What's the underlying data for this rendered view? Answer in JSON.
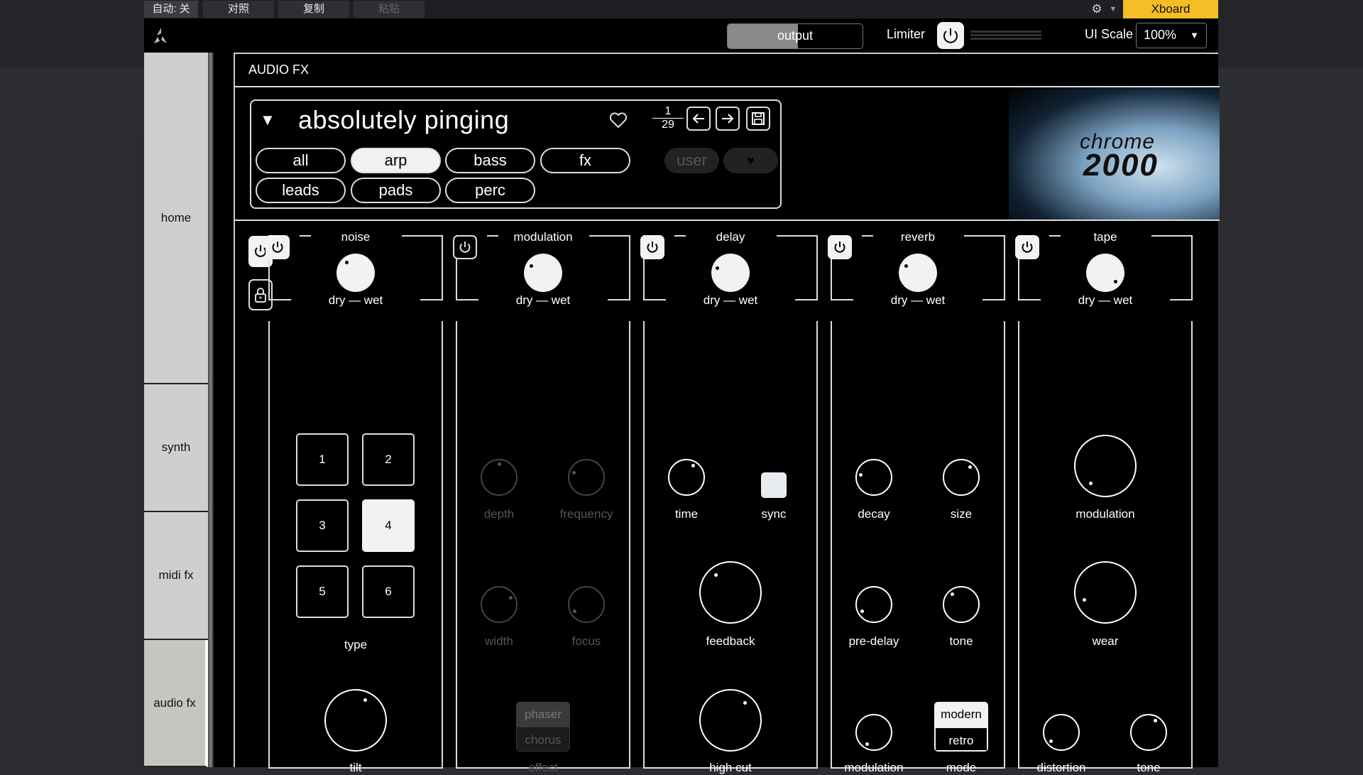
{
  "host": {
    "auto_label": "自动: 关",
    "compare_label": "对照",
    "copy_label": "复制",
    "paste_label": "粘贴",
    "xboard_label": "Xboard"
  },
  "top": {
    "output_label": "output",
    "output_level": 0.52,
    "limiter_label": "Limiter",
    "ui_scale_label": "UI Scale",
    "ui_scale_value": "100%"
  },
  "sidebar": {
    "items": [
      {
        "label": "home"
      },
      {
        "label": "synth"
      },
      {
        "label": "midi fx"
      },
      {
        "label": "audio fx"
      }
    ]
  },
  "header": {
    "title": "AUDIO FX"
  },
  "preset": {
    "name": "absolutely pinging",
    "index": "1",
    "total": "29",
    "categories": [
      "all",
      "arp",
      "bass",
      "fx",
      "leads",
      "pads",
      "perc"
    ],
    "selected": "arp",
    "user_label": "user"
  },
  "art": {
    "line1": "chrome",
    "line2": "2000"
  },
  "effects": {
    "drywet_label": "dry — wet",
    "noise": {
      "title": "noise",
      "type_label": "type",
      "types": [
        "1",
        "2",
        "3",
        "4",
        "5",
        "6"
      ],
      "selected_type": "4",
      "tilt_label": "tilt"
    },
    "modulation": {
      "title": "modulation",
      "depth_label": "depth",
      "frequency_label": "frequency",
      "width_label": "width",
      "focus_label": "focus",
      "effect_label": "effect",
      "effect_options": [
        "phaser",
        "chorus"
      ]
    },
    "delay": {
      "title": "delay",
      "time_label": "time",
      "sync_label": "sync",
      "feedback_label": "feedback",
      "highcut_label": "high cut"
    },
    "reverb": {
      "title": "reverb",
      "decay_label": "decay",
      "size_label": "size",
      "predelay_label": "pre-delay",
      "tone_label": "tone",
      "modulation_label": "modulation",
      "mode_label": "mode",
      "mode_options": [
        "modern",
        "retro"
      ],
      "mode_selected": "retro"
    },
    "tape": {
      "title": "tape",
      "modulation_label": "modulation",
      "wear_label": "wear",
      "distortion_label": "distortion",
      "tone_label": "tone"
    }
  },
  "colors": {
    "accent": "#f5bd26",
    "bg": "#000000",
    "panel_line": "#dddddd"
  }
}
